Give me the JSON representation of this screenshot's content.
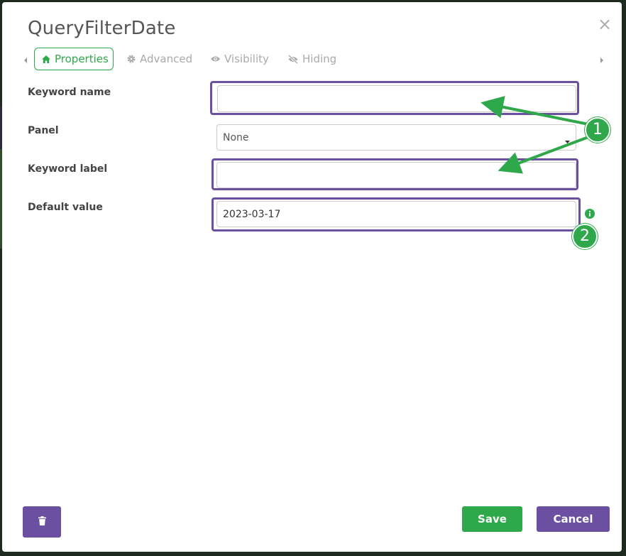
{
  "dialog": {
    "title": "QueryFilterDate",
    "close_symbol": "×"
  },
  "tabs": [
    {
      "label": "Properties",
      "icon": "home-icon",
      "active": true
    },
    {
      "label": "Advanced",
      "icon": "gear-icon",
      "active": false
    },
    {
      "label": "Visibility",
      "icon": "eye-icon",
      "active": false
    },
    {
      "label": "Hiding",
      "icon": "eye-slash-icon",
      "active": false
    }
  ],
  "fields": {
    "keyword_name": {
      "label": "Keyword name",
      "value": ""
    },
    "panel": {
      "label": "Panel",
      "selected": "None"
    },
    "keyword_label": {
      "label": "Keyword label",
      "value": ""
    },
    "default_value": {
      "label": "Default value",
      "value": "2023-03-17"
    }
  },
  "annotations": {
    "badge_1": "1",
    "badge_2": "2",
    "highlight_color": "#6b4fa0",
    "marker_color": "#2ea84a"
  },
  "footer": {
    "save_label": "Save",
    "cancel_label": "Cancel",
    "delete_icon": "trash-icon"
  },
  "colors": {
    "accent_green": "#2ea84a",
    "accent_purple": "#6b4fa0"
  }
}
